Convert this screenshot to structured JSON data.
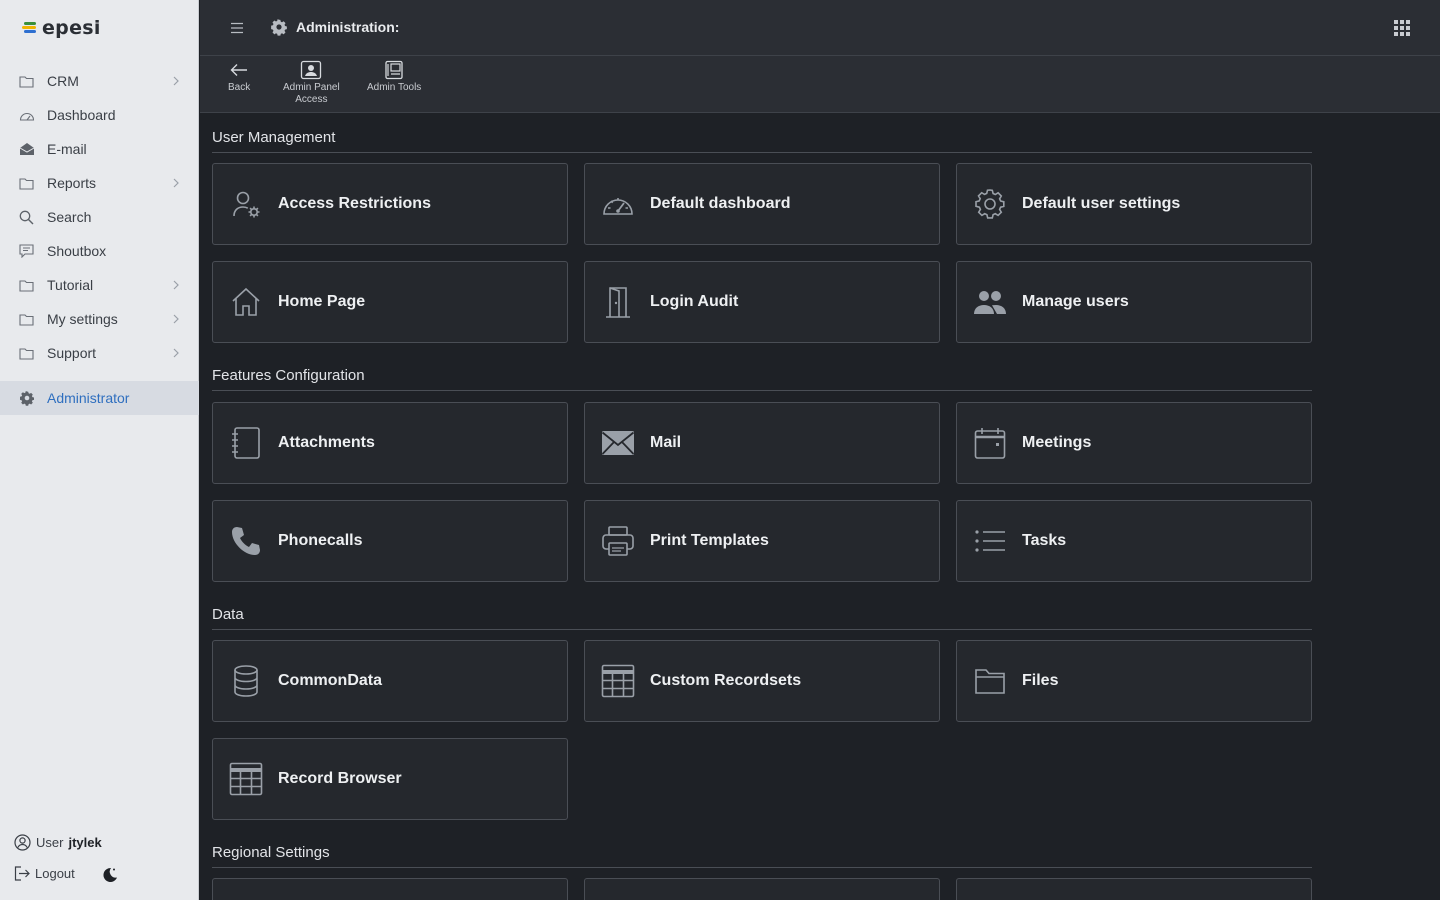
{
  "app": {
    "logo_text": "epesi"
  },
  "sidebar": {
    "items": [
      {
        "label": "CRM",
        "icon": "folder-icon",
        "has_children": true
      },
      {
        "label": "Dashboard",
        "icon": "dashboard-icon",
        "has_children": false
      },
      {
        "label": "E-mail",
        "icon": "mail-open-icon",
        "has_children": false
      },
      {
        "label": "Reports",
        "icon": "folder-icon",
        "has_children": true
      },
      {
        "label": "Search",
        "icon": "search-icon",
        "has_children": false
      },
      {
        "label": "Shoutbox",
        "icon": "chat-icon",
        "has_children": false
      },
      {
        "label": "Tutorial",
        "icon": "folder-icon",
        "has_children": true
      },
      {
        "label": "My settings",
        "icon": "folder-icon",
        "has_children": true
      },
      {
        "label": "Support",
        "icon": "folder-icon",
        "has_children": true
      }
    ],
    "active_item": {
      "label": "Administrator",
      "icon": "gear-icon"
    },
    "user_label": "User",
    "username": "jtylek",
    "logout_label": "Logout"
  },
  "header": {
    "title": "Administration:"
  },
  "toolbar": {
    "back_label": "Back",
    "admin_panel_line1": "Admin Panel",
    "admin_panel_line2": "Access",
    "admin_tools_label": "Admin Tools"
  },
  "sections": {
    "user_management": {
      "title": "User Management",
      "cards": [
        "Access Restrictions",
        "Default dashboard",
        "Default user settings",
        "Home Page",
        "Login Audit",
        "Manage users"
      ]
    },
    "features": {
      "title": "Features Configuration",
      "cards": [
        "Attachments",
        "Mail",
        "Meetings",
        "Phonecalls",
        "Print Templates",
        "Tasks"
      ]
    },
    "data": {
      "title": "Data",
      "cards": [
        "CommonData",
        "Custom Recordsets",
        "Files",
        "Record Browser"
      ]
    },
    "regional": {
      "title": "Regional Settings"
    }
  },
  "colors": {
    "accent": "#2f6fbf",
    "card_bg": "#25282d",
    "page_bg": "#1e2126",
    "sidebar_bg": "#e8eaed"
  }
}
